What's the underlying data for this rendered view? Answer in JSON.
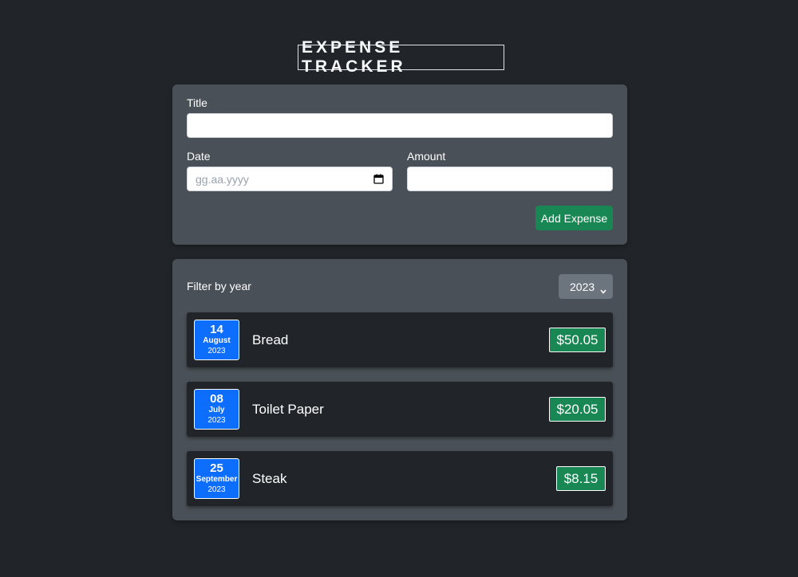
{
  "header": {
    "title": "EXPENSE TRACKER"
  },
  "form": {
    "title_label": "Title",
    "title_value": "",
    "date_label": "Date",
    "date_placeholder": "gg.aa.yyyy",
    "amount_label": "Amount",
    "amount_value": "",
    "add_button": "Add Expense"
  },
  "filter": {
    "label": "Filter by year",
    "selected_year": "2023"
  },
  "expenses": [
    {
      "day": "14",
      "month": "August",
      "year": "2023",
      "title": "Bread",
      "amount": "$50.05"
    },
    {
      "day": "08",
      "month": "July",
      "year": "2023",
      "title": "Toilet Paper",
      "amount": "$20.05"
    },
    {
      "day": "25",
      "month": "September",
      "year": "2023",
      "title": "Steak",
      "amount": "$8.15"
    }
  ],
  "colors": {
    "background": "#212529",
    "panel": "#495057",
    "accent_green": "#198754",
    "date_blue": "#0d6efd",
    "select_gray": "#6c757d"
  },
  "icons": {
    "date_picker": "calendar-icon",
    "select_arrow": "chevron-down-icon"
  }
}
